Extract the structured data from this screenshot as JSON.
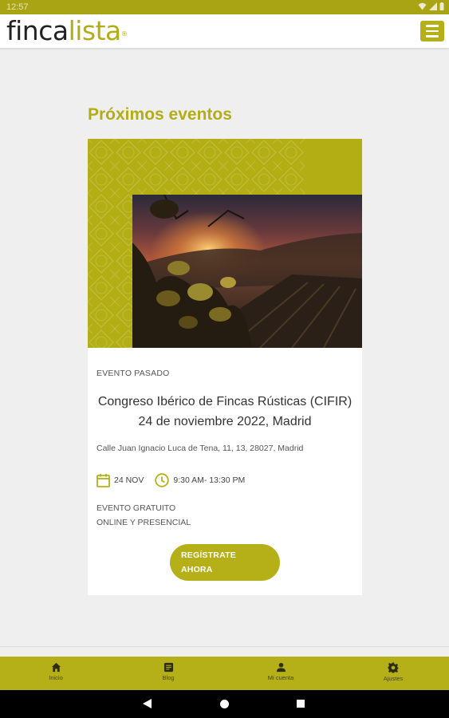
{
  "status_bar": {
    "time": "12:57"
  },
  "header": {
    "logo_part1": "finca",
    "logo_part2": "lista",
    "logo_mark": "®"
  },
  "main": {
    "section_title": "Próximos eventos",
    "event": {
      "status": "EVENTO PASADO",
      "title": "Congreso Ibérico de Fincas Rústicas (CIFIR) 24 de noviembre 2022, Madrid",
      "address": "Calle Juan Ignacio Luca de Tena, 11, 13, 28027, Madrid",
      "date": "24 NOV",
      "time": "9:30 AM- 13:30 PM",
      "price": "EVENTO GRATUITO",
      "mode": "ONLINE Y PRESENCIAL",
      "register_label_line1": "REGÍSTRATE",
      "register_label_line2": "AHORA"
    }
  },
  "bottom_nav": {
    "items": [
      {
        "label": "Inicio",
        "icon": "home-icon"
      },
      {
        "label": "Blog",
        "icon": "blog-icon"
      },
      {
        "label": "Mi cuenta",
        "icon": "account-icon"
      },
      {
        "label": "Ajustes",
        "icon": "settings-icon"
      }
    ]
  },
  "colors": {
    "brand": "#b5b017",
    "brand_text": "#b2ad16",
    "background": "#efefef"
  }
}
